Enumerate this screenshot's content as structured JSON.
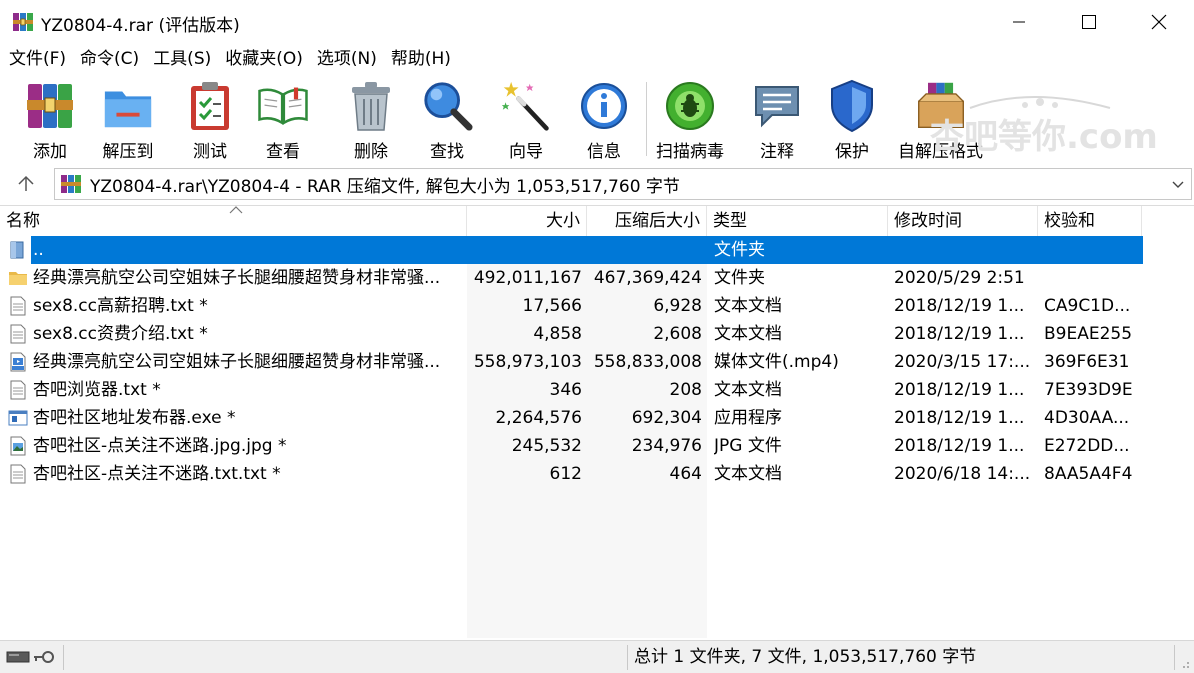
{
  "window": {
    "title": "YZ0804-4.rar (评估版本)"
  },
  "menu": [
    "文件(F)",
    "命令(C)",
    "工具(S)",
    "收藏夹(O)",
    "选项(N)",
    "帮助(H)"
  ],
  "toolbar": {
    "add": "添加",
    "extract": "解压到",
    "test": "测试",
    "view": "查看",
    "delete": "删除",
    "find": "查找",
    "wizard": "向导",
    "info": "信息",
    "virus": "扫描病毒",
    "comment": "注释",
    "protect": "保护",
    "sfx": "自解压格式"
  },
  "watermark": "杏吧等你.com",
  "address": {
    "path": "YZ0804-4.rar\\YZ0804-4 - RAR 压缩文件, 解包大小为 1,053,517,760 字节"
  },
  "columns": {
    "name": "名称",
    "size": "大小",
    "packed": "压缩后大小",
    "type": "类型",
    "modified": "修改时间",
    "crc": "校验和"
  },
  "files": [
    {
      "icon": "up-folder-icon",
      "name": "..",
      "size": "",
      "packed": "",
      "type": "文件夹",
      "modified": "",
      "crc": ""
    },
    {
      "icon": "folder-icon",
      "name": "经典漂亮航空公司空姐妹子长腿细腰超赞身材非常骚...",
      "size": "492,011,167",
      "packed": "467,369,424",
      "type": "文件夹",
      "modified": "2020/5/29 2:51",
      "crc": ""
    },
    {
      "icon": "text-file-icon",
      "name": "sex8.cc高薪招聘.txt *",
      "size": "17,566",
      "packed": "6,928",
      "type": "文本文档",
      "modified": "2018/12/19 1...",
      "crc": "CA9C1D..."
    },
    {
      "icon": "text-file-icon",
      "name": "sex8.cc资费介绍.txt *",
      "size": "4,858",
      "packed": "2,608",
      "type": "文本文档",
      "modified": "2018/12/19 1...",
      "crc": "B9EAE255"
    },
    {
      "icon": "video-file-icon",
      "name": "经典漂亮航空公司空姐妹子长腿细腰超赞身材非常骚...",
      "size": "558,973,103",
      "packed": "558,833,008",
      "type": "媒体文件(.mp4)",
      "modified": "2020/3/15 17:...",
      "crc": "369F6E31"
    },
    {
      "icon": "text-file-icon",
      "name": "杏吧浏览器.txt *",
      "size": "346",
      "packed": "208",
      "type": "文本文档",
      "modified": "2018/12/19 1...",
      "crc": "7E393D9E"
    },
    {
      "icon": "exe-file-icon",
      "name": "杏吧社区地址发布器.exe *",
      "size": "2,264,576",
      "packed": "692,304",
      "type": "应用程序",
      "modified": "2018/12/19 1...",
      "crc": "4D30AA..."
    },
    {
      "icon": "image-file-icon",
      "name": "杏吧社区-点关注不迷路.jpg.jpg *",
      "size": "245,532",
      "packed": "234,976",
      "type": "JPG 文件",
      "modified": "2018/12/19 1...",
      "crc": "E272DD..."
    },
    {
      "icon": "text-file-icon",
      "name": "杏吧社区-点关注不迷路.txt.txt *",
      "size": "612",
      "packed": "464",
      "type": "文本文档",
      "modified": "2020/6/18 14:...",
      "crc": "8AA5A4F4"
    }
  ],
  "status": {
    "summary": "总计 1 文件夹, 7 文件, 1,053,517,760 字节"
  },
  "colors": {
    "selection": "#0078d7",
    "folder": "#f2c94c"
  }
}
